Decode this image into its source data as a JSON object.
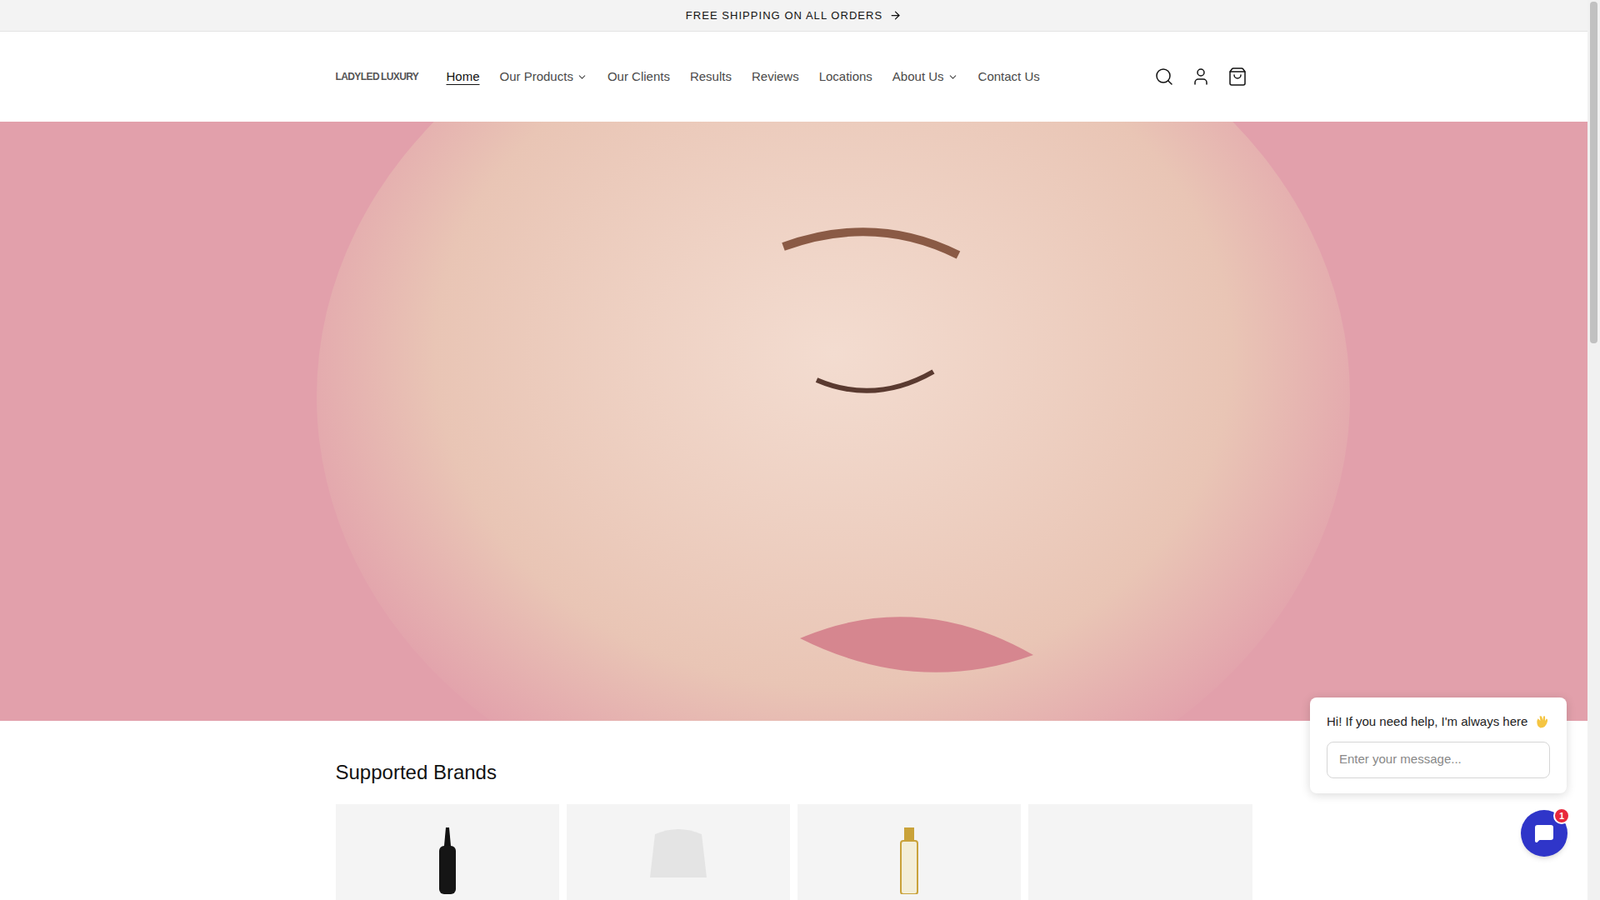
{
  "announcement": {
    "text": "FREE SHIPPING ON ALL ORDERS"
  },
  "logo": {
    "left": "LADYLED",
    "right": "LUXURY"
  },
  "nav": [
    {
      "label": "Home",
      "selected": true,
      "dropdown": false
    },
    {
      "label": "Our Products",
      "selected": false,
      "dropdown": true
    },
    {
      "label": "Our Clients",
      "selected": false,
      "dropdown": false
    },
    {
      "label": "Results",
      "selected": false,
      "dropdown": false
    },
    {
      "label": "Reviews",
      "selected": false,
      "dropdown": false
    },
    {
      "label": "Locations",
      "selected": false,
      "dropdown": false
    },
    {
      "label": "About Us",
      "selected": false,
      "dropdown": true
    },
    {
      "label": "Contact Us",
      "selected": false,
      "dropdown": false
    }
  ],
  "section": {
    "title": "Supported Brands"
  },
  "chat": {
    "greeting": "Hi! If you need help, I'm always here",
    "placeholder": "Enter your message...",
    "badge": "1"
  }
}
